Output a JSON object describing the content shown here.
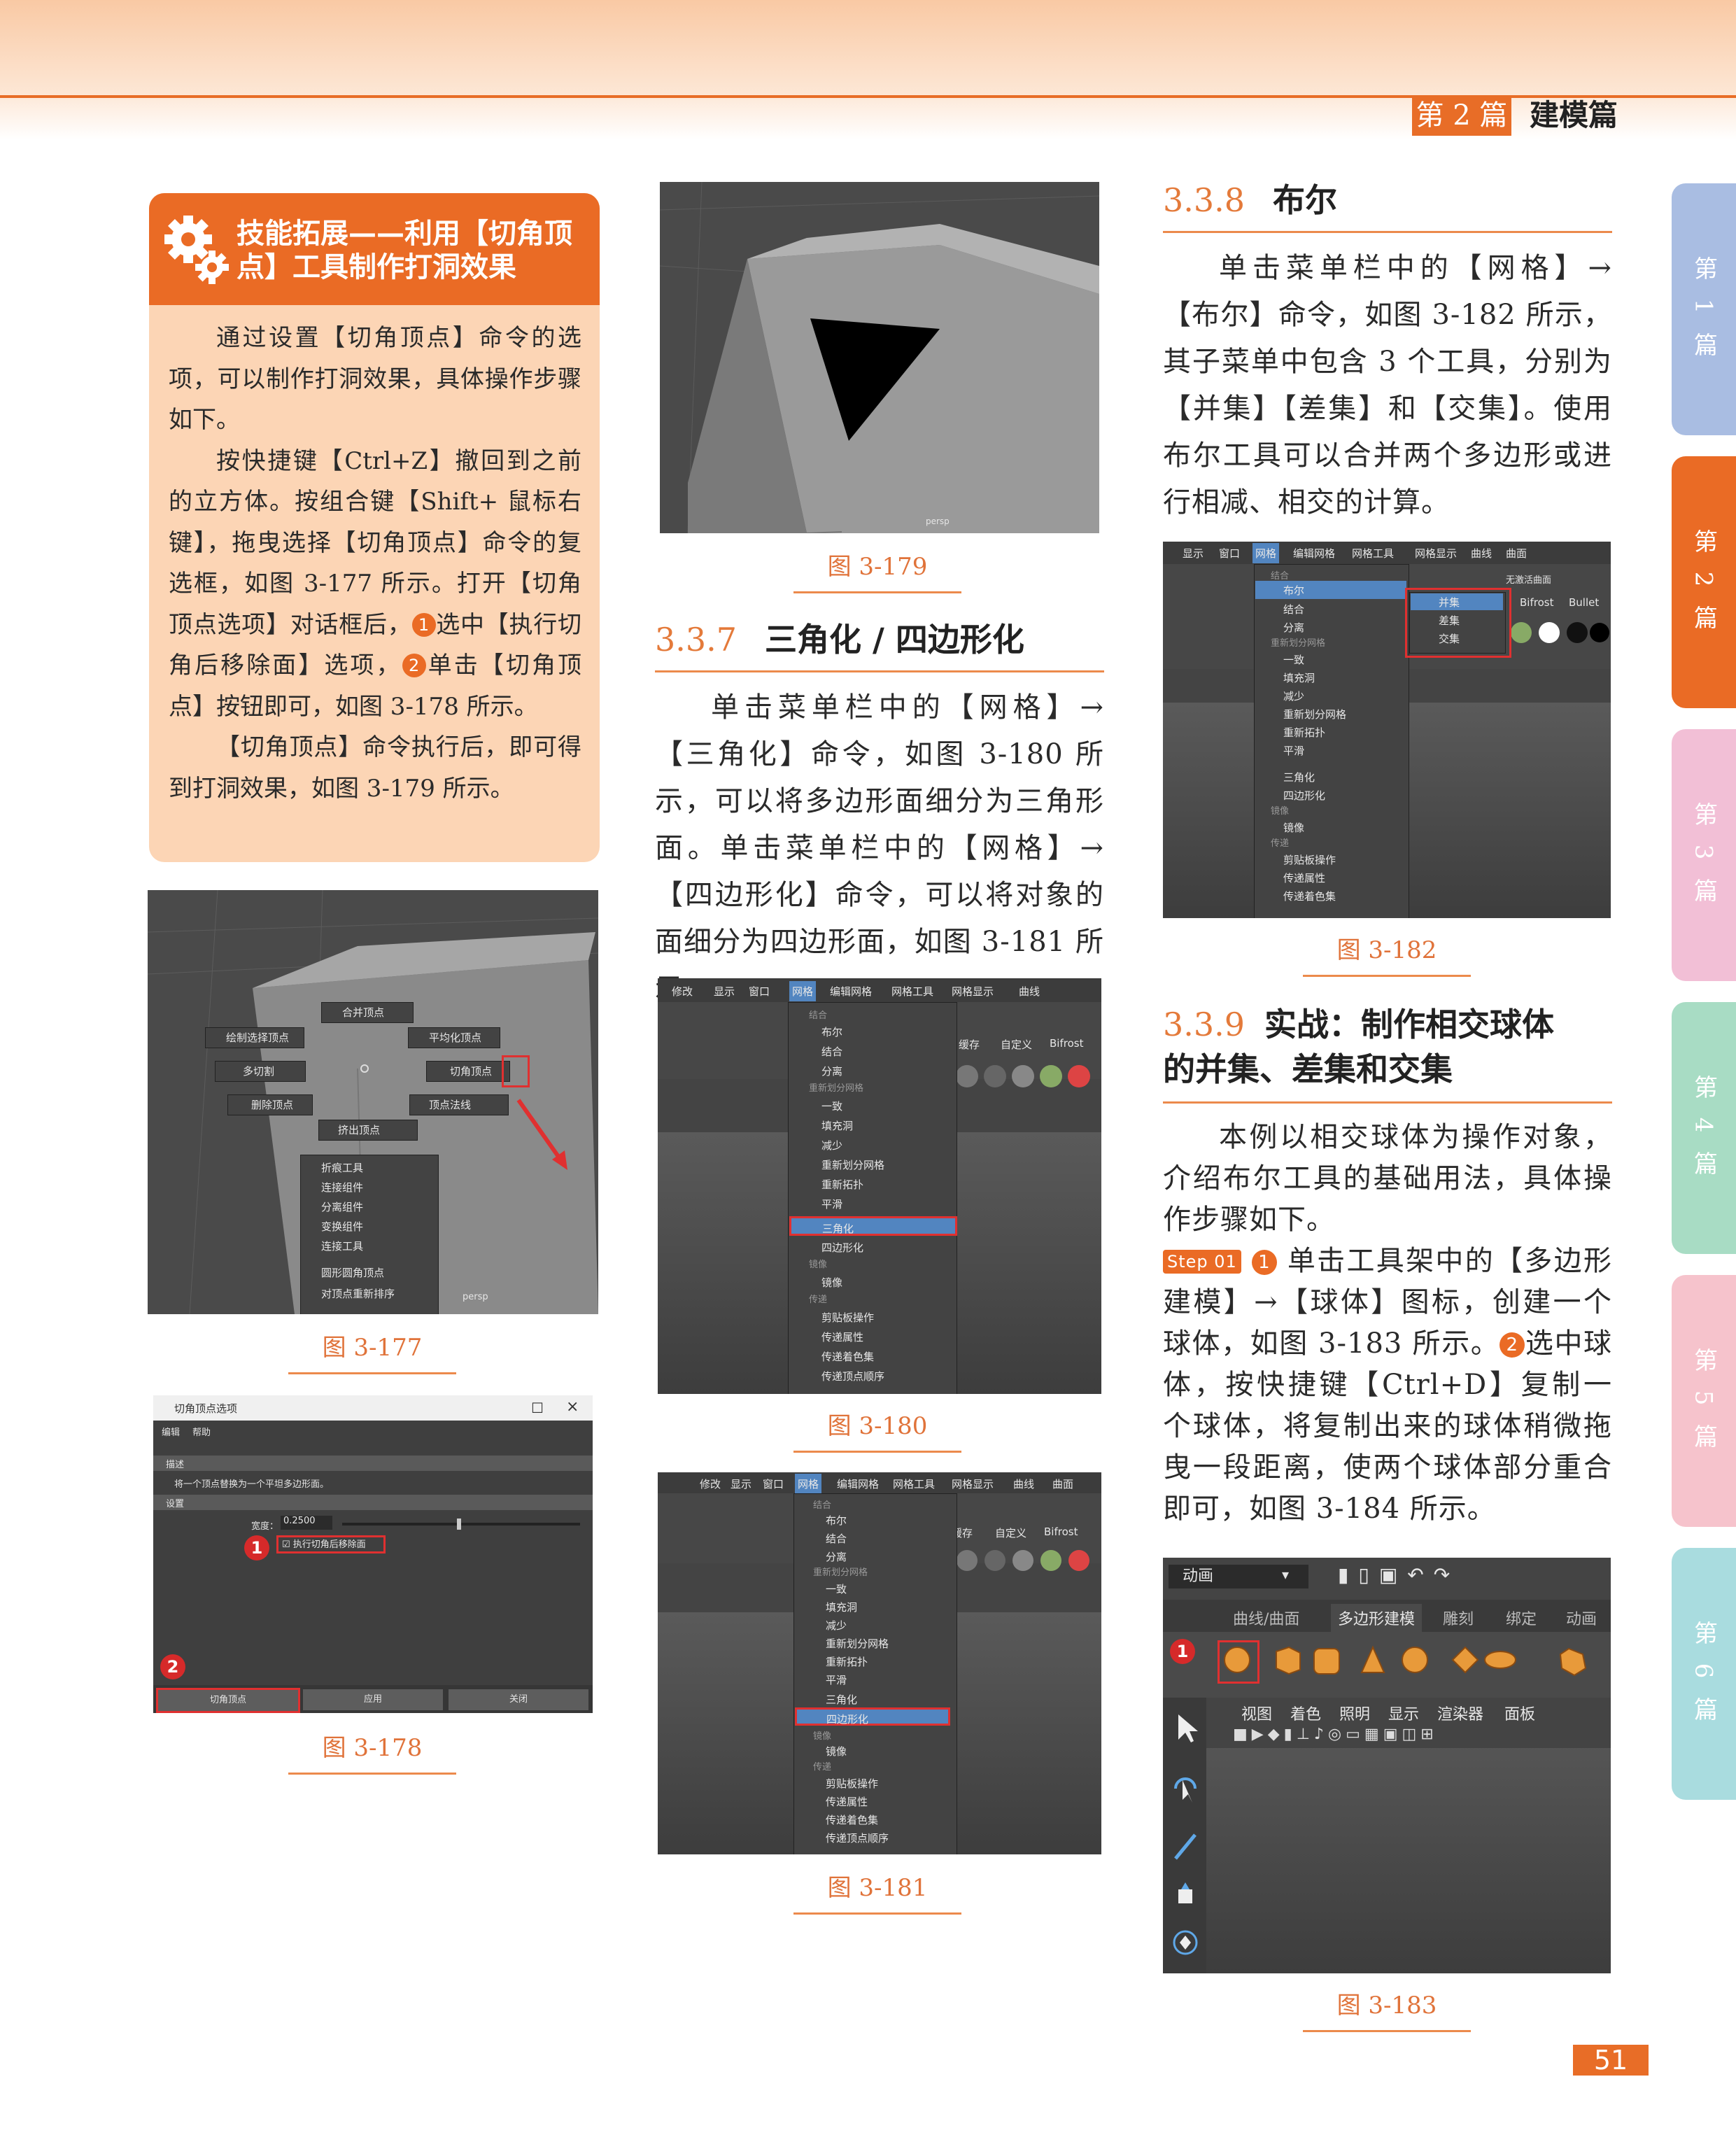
{
  "header": {
    "part": "第 2 篇",
    "title": "建模篇"
  },
  "side_tabs": [
    {
      "label": "第 1 篇",
      "color": "#a9bde2"
    },
    {
      "label": "第 2 篇",
      "color": "#ea6b25"
    },
    {
      "label": "第 3 篇",
      "color": "#f2bfd6"
    },
    {
      "label": "第 4 篇",
      "color": "#a8dcc4"
    },
    {
      "label": "第 5 篇",
      "color": "#f6c3cc"
    },
    {
      "label": "第 6 篇",
      "color": "#a9dcdf"
    }
  ],
  "skill_box": {
    "title": "技能拓展——利用【切角顶点】工具制作打洞效果",
    "p1": "通过设置【切角顶点】命令的选项，可以制作打洞效果，具体操作步骤如下。",
    "p2a": "按快捷键【Ctrl+Z】撤回到之前的立方体。按组合键【Shift+ 鼠标右键】，拖曳选择【切角顶点】命令的复选框，如图 3-177 所示。打开【切角顶点选项】对话框后，",
    "n1": "1",
    "p2b": "选中【执行切角后移除面】选项，",
    "n2": "2",
    "p2c": "单击【切角顶点】按钮即可，如图 3-178 所示。",
    "p3": "【切角顶点】命令执行后，即可得到打洞效果，如图 3-179 所示。"
  },
  "fig177": {
    "caption": "图 3-177",
    "items": [
      "合并顶点",
      "绘制选择顶点",
      "平均化顶点",
      "多切割",
      "切角顶点",
      "删除顶点",
      "顶点法线",
      "挤出顶点"
    ],
    "menu": [
      "折痕工具",
      "连接组件",
      "分离组件",
      "变换组件",
      "连接工具",
      "圆形圆角顶点",
      "对顶点重新排序"
    ],
    "persp": "persp"
  },
  "fig178": {
    "caption": "图 3-178",
    "window_title": "切角顶点选项",
    "menu": [
      "编辑",
      "帮助"
    ],
    "section1": "描述",
    "desc": "将一个顶点替换为一个平坦多边形面。",
    "section2": "设置",
    "width_label": "宽度：",
    "width_value": "0.2500",
    "checkbox": "执行切角后移除面",
    "buttons": [
      "切角顶点",
      "应用",
      "关闭"
    ],
    "marks": [
      "1",
      "2"
    ]
  },
  "fig179": {
    "caption": "图 3-179",
    "persp": "persp"
  },
  "s337": {
    "num": "3.3.7",
    "title": "三角化 / 四边形化",
    "text": "单击菜单栏中的【网格】→【三角化】命令，如图 3-180 所示，可以将多边形面细分为三角形面。单击菜单栏中的【网格】→【四边形化】命令，可以将对象的面细分为四边形面，如图 3-181 所示。"
  },
  "mesh_menu": {
    "menubar": [
      "修改",
      "显示",
      "窗口",
      "网格",
      "编辑网格",
      "网格工具",
      "网格显示",
      "曲线",
      "曲面"
    ],
    "items": [
      "结合",
      "布尔",
      "结合",
      "分离",
      "重新划分网格",
      "一致",
      "填充洞",
      "减少",
      "重新划分网格",
      "重新拓扑",
      "平滑",
      "三角化",
      "四边形化",
      "镜像",
      "镜像",
      "传递",
      "剪贴板操作",
      "传递属性",
      "传递着色集",
      "传递顶点顺序"
    ],
    "shelf": [
      "缓存",
      "自定义",
      "Bifrost"
    ]
  },
  "fig180": {
    "caption": "图 3-180",
    "highlight": "三角化"
  },
  "fig181": {
    "caption": "图 3-181",
    "highlight": "四边形化"
  },
  "s338": {
    "num": "3.3.8",
    "title": "布尔",
    "text": "单击菜单栏中的【网格】→【布尔】命令，如图 3-182 所示，其子菜单中包含 3 个工具，分别为【并集】【差集】和【交集】。使用布尔工具可以合并两个多边形或进行相减、相交的计算。"
  },
  "fig182": {
    "caption": "图 3-182",
    "submenu": [
      "并集",
      "差集",
      "交集"
    ],
    "shelf": [
      "Bifrost",
      "Bullet"
    ],
    "live": "无激活曲面"
  },
  "s339": {
    "num": "3.3.9",
    "title1": "实战：制作相交球体",
    "title2": "的并集、差集和交集",
    "intro": "本例以相交球体为操作对象，介绍布尔工具的基础用法，具体操作步骤如下。",
    "step": "Step 01",
    "n1": "1",
    "t1": "单击工具架中的【多边形建模】→【球体】图标，创建一个球体，如图 3-183 所示。",
    "n2": "2",
    "t2": "选中球体，按快捷键【Ctrl+D】复制一个球体，将复制出来的球体稍微拖曳一段距离，使两个球体部分重合即可，如图 3-184 所示。"
  },
  "fig183": {
    "caption": "图 3-183",
    "mode": "动画",
    "tabs": [
      "曲线/曲面",
      "多边形建模",
      "雕刻",
      "绑定",
      "动画"
    ],
    "panel": [
      "视图",
      "着色",
      "照明",
      "显示",
      "渲染器",
      "面板"
    ],
    "mark": "1"
  },
  "page_number": "51"
}
